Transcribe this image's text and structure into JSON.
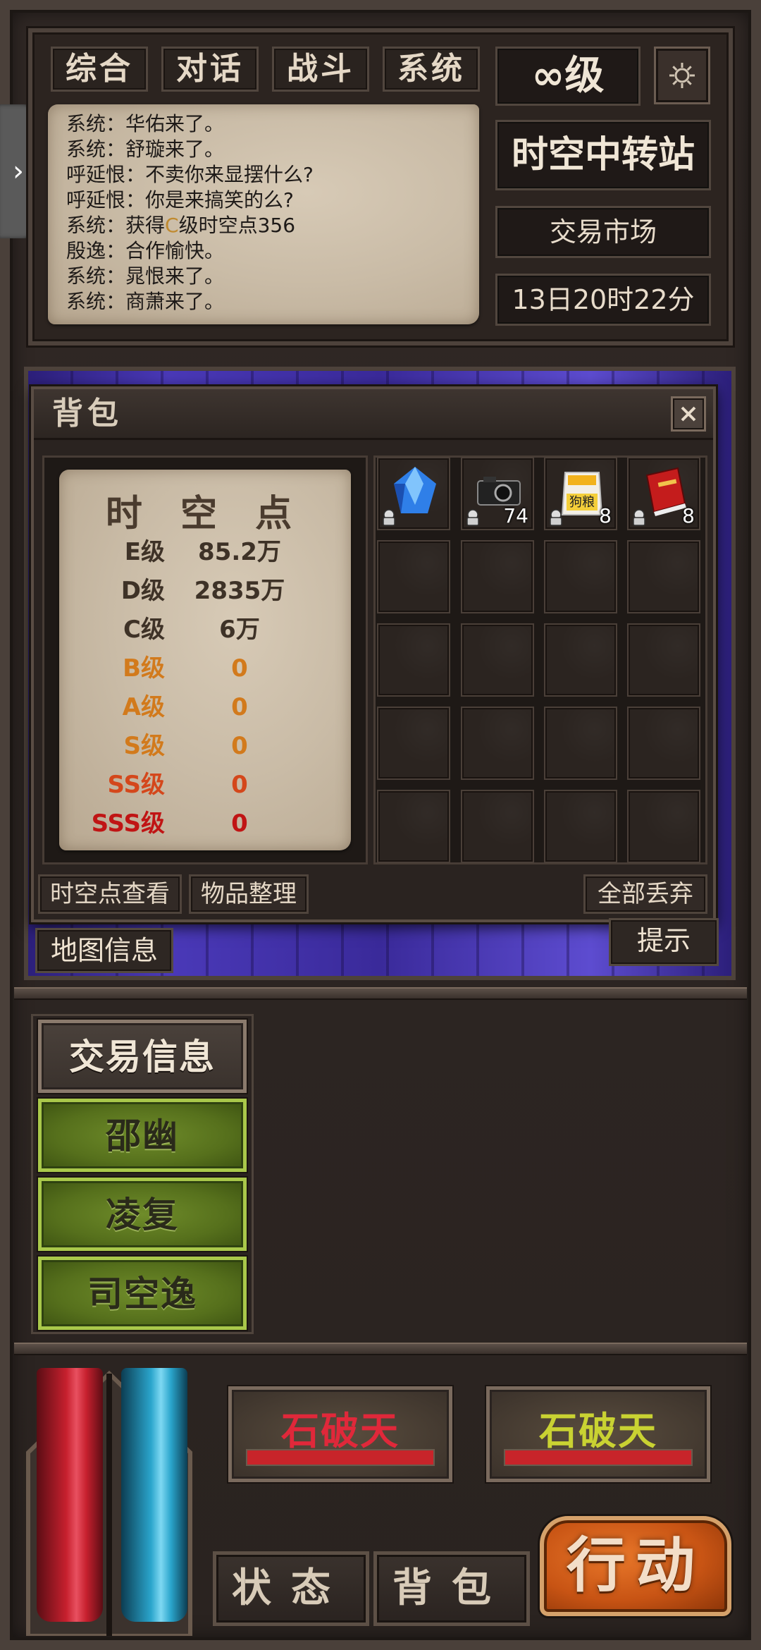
{
  "tabs": [
    "综合",
    "对话",
    "战斗",
    "系统"
  ],
  "level": "∞级",
  "location": "时空中转站",
  "market": "交易市场",
  "game_time": "13日20时22分",
  "chat": [
    {
      "speaker": "系统",
      "sep": "：",
      "pre": "华佑来了。",
      "tag": "",
      "post": ""
    },
    {
      "speaker": "系统",
      "sep": "：",
      "pre": "舒璇来了。",
      "tag": "",
      "post": ""
    },
    {
      "speaker": "呼延恨",
      "sep": "：",
      "pre": "不卖你来显摆什么?",
      "tag": "",
      "post": ""
    },
    {
      "speaker": "呼延恨",
      "sep": "：",
      "pre": "你是来搞笑的么?",
      "tag": "",
      "post": ""
    },
    {
      "speaker": "系统",
      "sep": "：",
      "pre": "获得",
      "tag": "C",
      "post": "级时空点356"
    },
    {
      "speaker": "殷逸",
      "sep": "：",
      "pre": "合作愉快。",
      "tag": "",
      "post": ""
    },
    {
      "speaker": "系统",
      "sep": "：",
      "pre": "晁恨来了。",
      "tag": "",
      "post": ""
    },
    {
      "speaker": "系统",
      "sep": "：",
      "pre": "商萧来了。",
      "tag": "",
      "post": ""
    }
  ],
  "bag": {
    "title": "背包",
    "points_title": "时 空 点",
    "points": [
      {
        "grade": "E级",
        "value": "85.2万",
        "color": "#3e3227"
      },
      {
        "grade": "D级",
        "value": "2835万",
        "color": "#3e3227"
      },
      {
        "grade": "C级",
        "value": "6万",
        "color": "#3e3227"
      },
      {
        "grade": "B级",
        "value": "0",
        "color": "#d27a1c"
      },
      {
        "grade": "A级",
        "value": "0",
        "color": "#d27a1c"
      },
      {
        "grade": "S级",
        "value": "0",
        "color": "#d27a1c"
      },
      {
        "grade": "SS级",
        "value": "0",
        "color": "#d4471b"
      },
      {
        "grade": "SSS级",
        "value": "0",
        "color": "#c01414"
      }
    ],
    "items": [
      {
        "name": "blue-crystal-icon",
        "qty": ""
      },
      {
        "name": "camera-icon",
        "qty": "74"
      },
      {
        "name": "dog-food-bag-icon",
        "qty": "8",
        "label": "狗粮"
      },
      {
        "name": "red-book-icon",
        "qty": "8"
      }
    ],
    "buttons": {
      "view_points": "时空点查看",
      "sort": "物品整理",
      "discard_all": "全部丢弃"
    }
  },
  "map_info": "地图信息",
  "hint": "提示",
  "npcs": [
    {
      "label": "交易信息",
      "style": "gray"
    },
    {
      "label": "邵幽",
      "style": "green"
    },
    {
      "label": "凌复",
      "style": "green"
    },
    {
      "label": "司空逸",
      "style": "green"
    }
  ],
  "enemies": [
    {
      "name": "石破天",
      "color": "#e0283a",
      "hp": 1.0
    },
    {
      "name": "石破天",
      "color": "#c9d232",
      "hp": 1.0
    }
  ],
  "bottom_tabs": {
    "status": "状态",
    "bag": "背包"
  },
  "action": "行动",
  "vials": {
    "hp_color": "#c7202e",
    "mp_color": "#2aa5cc"
  }
}
